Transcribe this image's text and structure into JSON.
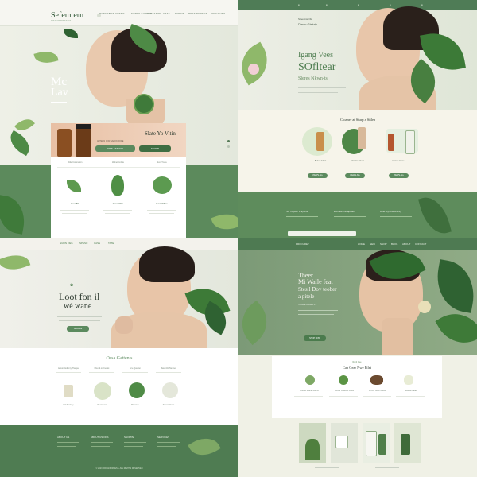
{
  "tl": {
    "logo_title": "Sefemtern",
    "logo_subtitle": "ORGANWRCESS",
    "nav": [
      "RONNEBOT",
      "CREME",
      "SORES SUTECE",
      "PRSTANTS",
      "CASE",
      "TITENT",
      "PREFIDDRENT",
      "ORCACIST"
    ],
    "hero_line1": "Mc",
    "hero_line2": "Lav",
    "product_title": "Slate Yo Vitin",
    "product_sub": "ANTEEN COR SALON RODE",
    "btn1": "SPIS ASTERO",
    "btn2": "SUTAR",
    "features": [
      "Wite Commeton",
      "Wilnet Corfite",
      "Sxor Trelia"
    ],
    "feature_items": [
      "Geus Bfin",
      "Mwsed Rive",
      "Hosal Wiffen"
    ]
  },
  "tr": {
    "eyebrow": "Stoevlnsr Ole",
    "sub": "Dastn Gleivty",
    "title1": "Igang Vees",
    "title2": "SOfltear",
    "tagline": "Sleres Nkwn-ts",
    "section_title": "Cloaner at Sturp a Sitlea",
    "products": [
      "Bulan Mert",
      "Siruks Rust",
      "Grave Fare"
    ],
    "cta": "VIEWS ALL",
    "footer_cols": [
      "Scr Kepuer Parpame",
      "Ecimale Csuapthan",
      "Dpet Gyr Casaminly"
    ]
  },
  "bl": {
    "logo": "NULIN FIES",
    "nav": [
      "SPESO",
      "CASE",
      "TATE"
    ],
    "hero1": "Loot fon il",
    "hero2": "wé wane",
    "cta": "SHOPPE",
    "section_title": "Ossa Gatten s",
    "col_titles": [
      "Accord Edierny Thanpe",
      "Riso lit os Cenlet",
      "E le Qaselei",
      "Barentlin Tanetes"
    ],
    "product_names": [
      "Ltd Tewlaey",
      "Weel Cout",
      "Bnaccos",
      "Terco Winefs"
    ],
    "footer_cols": [
      "ABOUT US",
      "ABOUT US OPS",
      "SHOPPE",
      "SERVICES"
    ],
    "copyright": "© 2023 ORGANWRCESS. ALL RIGHTS RESERVED"
  },
  "br": {
    "nav": [
      "HOME",
      "NEW",
      "SHOP",
      "BLOG",
      "ABOUT",
      "CONTACT"
    ],
    "brand": "PROCURET",
    "hero1": "Theer",
    "hero2": "Mi Walle feat",
    "hero3": "Stesil Dov teober",
    "hero4": "a pitele",
    "eyebrow": "HOSNIE REAIEL PS",
    "cta": "SHOP NOW",
    "card_eyebrow": "Ronil Gue",
    "card_title": "Can Gear Nwe Filet",
    "items": [
      "Brusse Riante Bauns",
      "Brozle Orwerns Fuws",
      "Brozie Sreen Fuwm",
      "Swadle Faias"
    ]
  }
}
